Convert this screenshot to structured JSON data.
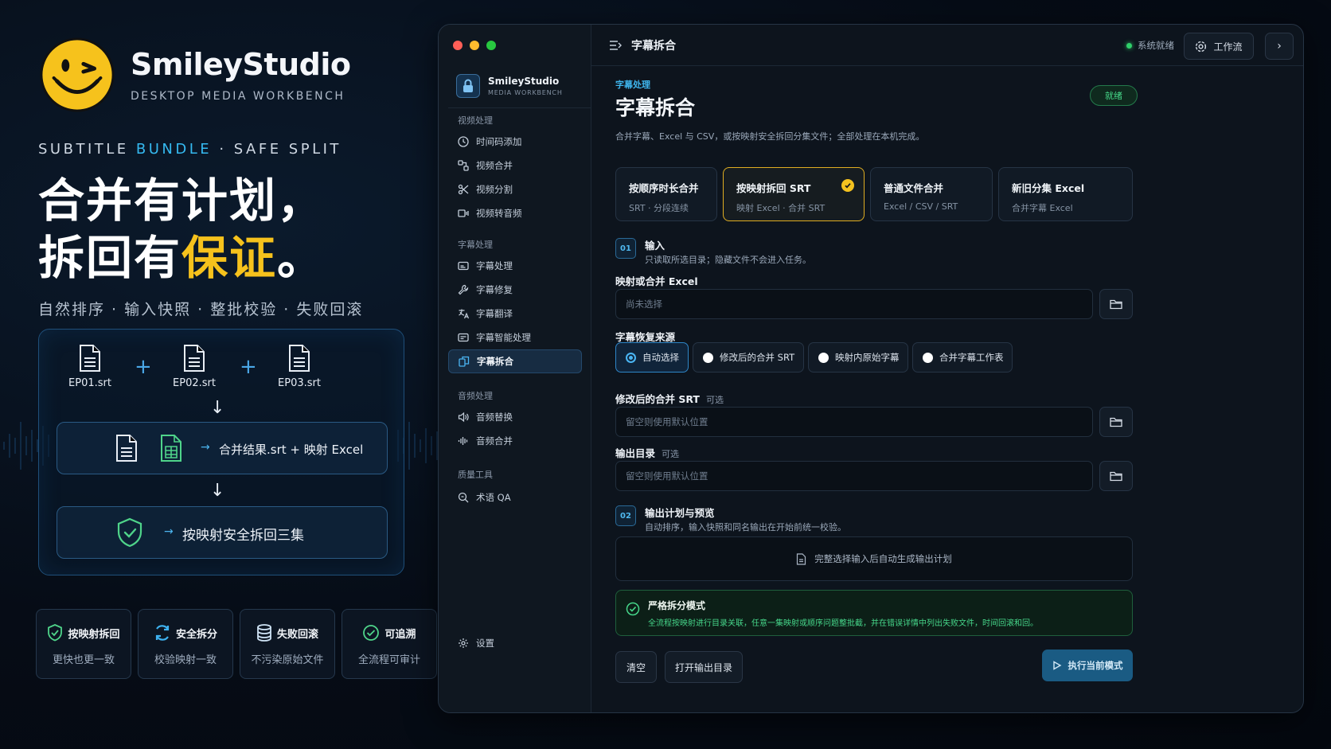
{
  "promo": {
    "brand_name": "SmileyStudio",
    "brand_sub": "DESKTOP MEDIA WORKBENCH",
    "tagline_a": "SUBTITLE ",
    "tagline_b": "BUNDLE",
    "tagline_c": " · SAFE SPLIT",
    "headline_1": "合并有计划，",
    "headline_2a": "拆回有",
    "headline_2b": "保证",
    "headline_2c": "。",
    "subline": "自然排序 · 输入快照 · 整批校验 · 失败回滚",
    "files": [
      "EP01.srt",
      "EP02.srt",
      "EP03.srt"
    ],
    "merge_text": "合并结果.srt + 映射 Excel",
    "split_text": "按映射安全拆回三集",
    "badges": [
      {
        "title": "按映射拆回",
        "sub": "更快也更一致"
      },
      {
        "title": "安全拆分",
        "sub": "校验映射一致"
      },
      {
        "title": "失败回滚",
        "sub": "不污染原始文件"
      },
      {
        "title": "可追溯",
        "sub": "全流程可审计"
      }
    ]
  },
  "app": {
    "brand_name": "SmileyStudio",
    "brand_sub": "MEDIA WORKBENCH",
    "topbar": {
      "title": "字幕拆合",
      "status": "系统就绪",
      "workflow": "工作流"
    },
    "sidebar": {
      "groups": [
        "视频处理",
        "字幕处理",
        "音频处理",
        "质量工具"
      ],
      "video": [
        "时间码添加",
        "视频合并",
        "视频分割",
        "视频转音频"
      ],
      "subtitle": [
        "字幕处理",
        "字幕修复",
        "字幕翻译",
        "字幕智能处理",
        "字幕拆合"
      ],
      "audio": [
        "音频替换",
        "音频合并"
      ],
      "quality": [
        "术语 QA"
      ],
      "settings": "设置"
    },
    "main": {
      "crumb": "字幕处理",
      "title": "字幕拆合",
      "status_badge": "就绪",
      "description": "合并字幕、Excel 与 CSV，或按映射安全拆回分集文件；全部处理在本机完成。",
      "modes": [
        {
          "title": "按顺序时长合并",
          "sub": "SRT · 分段连续"
        },
        {
          "title": "按映射拆回 SRT",
          "sub": "映射 Excel · 合并 SRT"
        },
        {
          "title": "普通文件合并",
          "sub": "Excel / CSV / SRT"
        },
        {
          "title": "新旧分集 Excel",
          "sub": "合并字幕 Excel"
        }
      ],
      "step1": {
        "num": "01",
        "title": "输入",
        "sub": "只读取所选目录；隐藏文件不会进入任务。"
      },
      "mapping_label": "映射或合并 Excel",
      "mapping_placeholder": "尚未选择",
      "source_label": "字幕恢复来源",
      "sources": [
        "自动选择",
        "修改后的合并 SRT",
        "映射内原始字幕",
        "合并字幕工作表"
      ],
      "modified_label": "修改后的合并 SRT",
      "optional": "可选",
      "modified_placeholder": "留空则使用默认位置",
      "output_label": "输出目录",
      "output_placeholder": "留空则使用默认位置",
      "step2": {
        "num": "02",
        "title": "输出计划与预览",
        "sub": "自动排序，输入快照和同名输出在开始前统一校验。"
      },
      "plan_text": "完整选择输入后自动生成输出计划",
      "strict_title": "严格拆分模式",
      "strict_sub": "全流程按映射进行目录关联，任意一集映射或顺序问题整批截，并在错误详情中列出失败文件，时间回滚和回。",
      "clear": "清空",
      "open_output": "打开输出目录",
      "run": "执行当前模式"
    }
  },
  "colors": {
    "accent_blue": "#35b9f0",
    "accent_gold": "#f6c21c",
    "status_green": "#2fd06a"
  }
}
